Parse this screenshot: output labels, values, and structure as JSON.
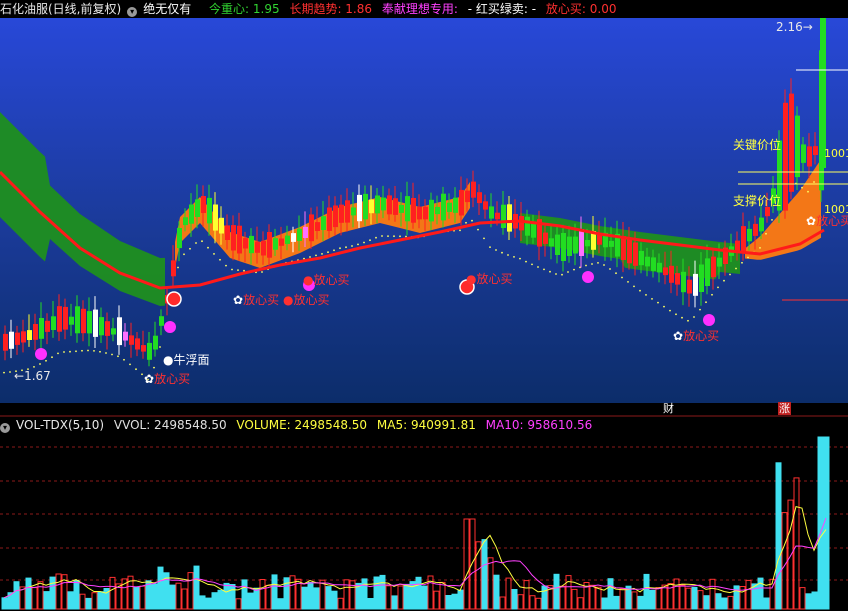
{
  "header": {
    "stock": "石化油服(日线,前复权)",
    "indicator_name": "绝无仅有",
    "items": [
      {
        "label": "今重心: 1.95",
        "color": "#31d331"
      },
      {
        "label": "长期趋势: 1.86",
        "color": "#ff3030"
      },
      {
        "label": "奉献理想专用:",
        "color": "#ff40ff"
      },
      {
        "label": "- 红买绿卖: -",
        "color": "#ffffff"
      },
      {
        "label": "放心买: 0.00",
        "color": "#ff3030"
      }
    ]
  },
  "volume_header": {
    "name": "VOL-TDX(5,10)",
    "items": [
      {
        "label": "VVOL: 2498548.50",
        "color": "#e0e0e0"
      },
      {
        "label": "VOLUME: 2498548.50",
        "color": "#ffff40"
      },
      {
        "label": "MA5: 940991.81",
        "color": "#ffff40"
      },
      {
        "label": "MA10: 958610.56",
        "color": "#ff40ff"
      }
    ]
  },
  "annotations": {
    "high_value": "2.16",
    "low_value": "1.67",
    "key_price": "关键价位",
    "support_price": "支撑价位",
    "key_price_value": "1001",
    "support_price_value": "1001",
    "niu_fu_mian": "牛浮面",
    "fang_xin_mai": "放心买",
    "cai_tag": "财",
    "zhang_tag": "涨"
  },
  "chart_data": {
    "type": "candlestick",
    "price_range": [
      1.67,
      2.16
    ],
    "volume_ma5": 940991.81,
    "volume_ma10": 958610.56,
    "volume_last": 2498548.5
  }
}
